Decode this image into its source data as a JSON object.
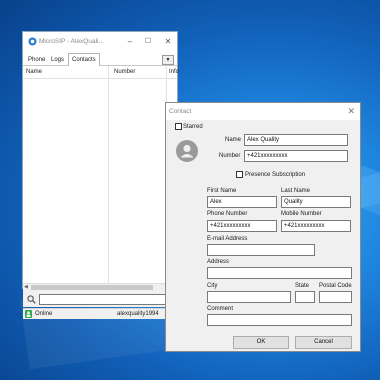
{
  "main_window": {
    "title": "MicroSIP - AlexQuali...",
    "tabs": [
      "Phone",
      "Logs",
      "Contacts"
    ],
    "active_tab": "Contacts",
    "columns": [
      "Name",
      "Number",
      "Info"
    ],
    "status": "Online",
    "account": "alexquality1994",
    "colors": {
      "status_icon": "#2fa84f"
    }
  },
  "contact_dialog": {
    "title": "Contact",
    "starred_label": "Starred",
    "name_label": "Name",
    "name_value": "Alex Quality",
    "number_label": "Number",
    "number_value": "+421xxxxxxxxx",
    "presence_label": "Presence Subscription",
    "first_name_label": "First Name",
    "first_name_value": "Alex",
    "last_name_label": "Last Name",
    "last_name_value": "Quality",
    "phone_number_label": "Phone Number",
    "phone_number_value": "+421xxxxxxxxx",
    "mobile_number_label": "Mobile Number",
    "mobile_number_value": "+421xxxxxxxxx",
    "email_label": "E-mail Address",
    "email_value": "",
    "address_label": "Address",
    "address_value": "",
    "city_label": "City",
    "city_value": "",
    "state_label": "State",
    "state_value": "",
    "postal_code_label": "Postal Code",
    "postal_code_value": "",
    "comment_label": "Comment",
    "comment_value": "",
    "ok_label": "OK",
    "cancel_label": "Cancel"
  },
  "icons": {
    "window_controls": {
      "minimize": "minimize-icon",
      "maximize": "maximize-icon",
      "close": "close-icon"
    },
    "search": "search-icon",
    "avatar": "avatar-icon"
  }
}
